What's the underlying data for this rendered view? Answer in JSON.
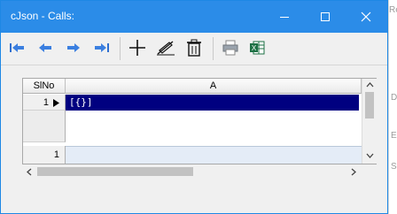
{
  "window": {
    "title": "cJson - Calls:",
    "controls": [
      "minimize-icon",
      "maximize-icon",
      "close-icon"
    ]
  },
  "background": {
    "right_text_1": "Recon",
    "right_text_2": "D",
    "right_text_3": "E",
    "right_text_4": "S"
  },
  "toolbar": {
    "buttons": [
      "first-record",
      "previous-record",
      "next-record",
      "last-record",
      "add-record",
      "edit-record",
      "delete-record",
      "print",
      "export-excel"
    ]
  },
  "grid": {
    "columns": [
      "SlNo",
      "A"
    ],
    "rows": [
      {
        "slno": "1",
        "value": "[{}]",
        "selected": true
      }
    ],
    "footer_count": "1"
  },
  "colors": {
    "titlebar": "#2b8ce8",
    "selection": "#000080",
    "excel_green": "#1e7145"
  }
}
